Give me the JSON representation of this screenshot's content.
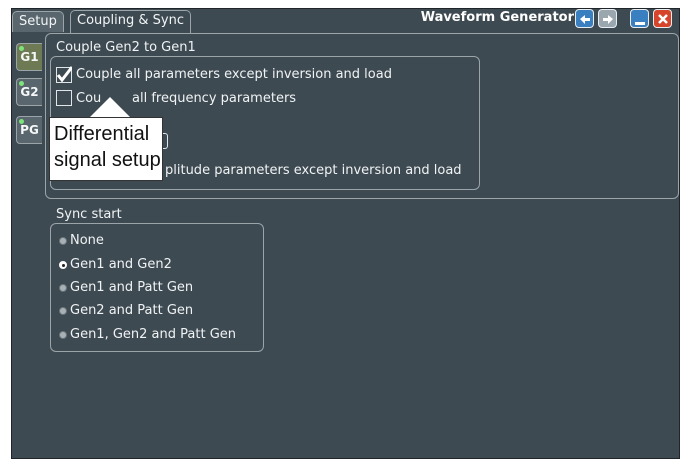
{
  "window": {
    "title": "Waveform Generator",
    "buttons": [
      "back-icon",
      "forward-icon",
      "minimize-icon",
      "close-icon"
    ]
  },
  "tabs": [
    {
      "label": "Setup",
      "active": false
    },
    {
      "label": "Coupling & Sync",
      "active": true
    }
  ],
  "side_tabs": [
    {
      "label": "G1",
      "active": true
    },
    {
      "label": "G2",
      "active": false
    },
    {
      "label": "PG",
      "active": false
    }
  ],
  "coupling": {
    "heading": "Couple Gen2 to Gen1",
    "options": [
      {
        "label": "Couple all parameters except inversion and load",
        "checked": true
      },
      {
        "label": "Couple all frequency parameters",
        "checked": false
      },
      {
        "label": "Couple all amplitude parameters except inversion and load",
        "checked": false
      }
    ],
    "visible_fragments": {
      "option2_prefix": "Cou",
      "option2_suffix": "all frequency parameters",
      "option3_suffix": "plitude parameters except inversion and load"
    }
  },
  "sync": {
    "heading": "Sync start",
    "options": [
      {
        "label": "None",
        "selected": false
      },
      {
        "label": "Gen1 and Gen2",
        "selected": true
      },
      {
        "label": "Gen1 and Patt Gen",
        "selected": false
      },
      {
        "label": "Gen2 and Patt Gen",
        "selected": false
      },
      {
        "label": "Gen1, Gen2 and Patt Gen",
        "selected": false
      }
    ]
  },
  "callout": {
    "line1": "Differential",
    "line2": "signal setup"
  },
  "colors": {
    "panel": "#3e4a52",
    "border": "#9aa4a9",
    "active_side_tab": "#6d7a53",
    "close_button": "#d6452b",
    "nav_button": "#3a7fc0"
  }
}
